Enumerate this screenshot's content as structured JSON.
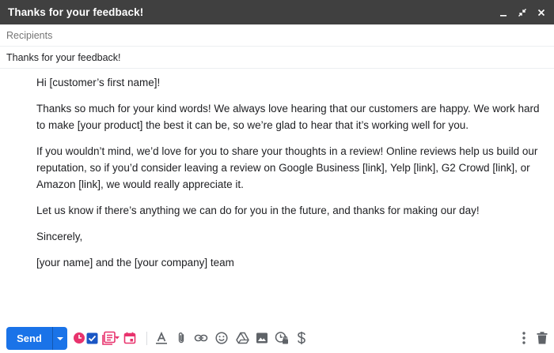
{
  "window": {
    "title": "Thanks for your feedback!"
  },
  "compose": {
    "recipients_placeholder": "Recipients",
    "subject": "Thanks for your feedback!",
    "body": [
      "Hi [customer’s first name]!",
      "Thanks so much for your kind words! We always love hearing that our customers are happy. We work hard to make [your product] the best it can be, so we’re glad to hear that it’s working well for you.",
      "If you wouldn’t mind, we’d love for you to share your thoughts in a review! Online reviews help us build our reputation, so if you’d consider leaving a review on Google Business [link], Yelp [link], G2 Crowd [link], or Amazon [link], we would really appreciate it.",
      "Let us know if there’s anything we can do for you in the future, and thanks for making our day!",
      "Sincerely,",
      "[your name] and the [your company] team"
    ]
  },
  "toolbar": {
    "send_label": "Send",
    "colors": {
      "send": "#1a73e8",
      "addon_red": "#e8336d",
      "addon_blue": "#1a56c4",
      "icon_grey": "#5f6368"
    },
    "icons": [
      "schedule-icon",
      "checkbox-icon",
      "templates-icon",
      "calendar-icon",
      "format-text-icon",
      "attach-icon",
      "link-icon",
      "emoji-icon",
      "drive-icon",
      "photo-icon",
      "confidential-icon",
      "dollar-icon",
      "more-vert-icon",
      "trash-icon"
    ]
  }
}
